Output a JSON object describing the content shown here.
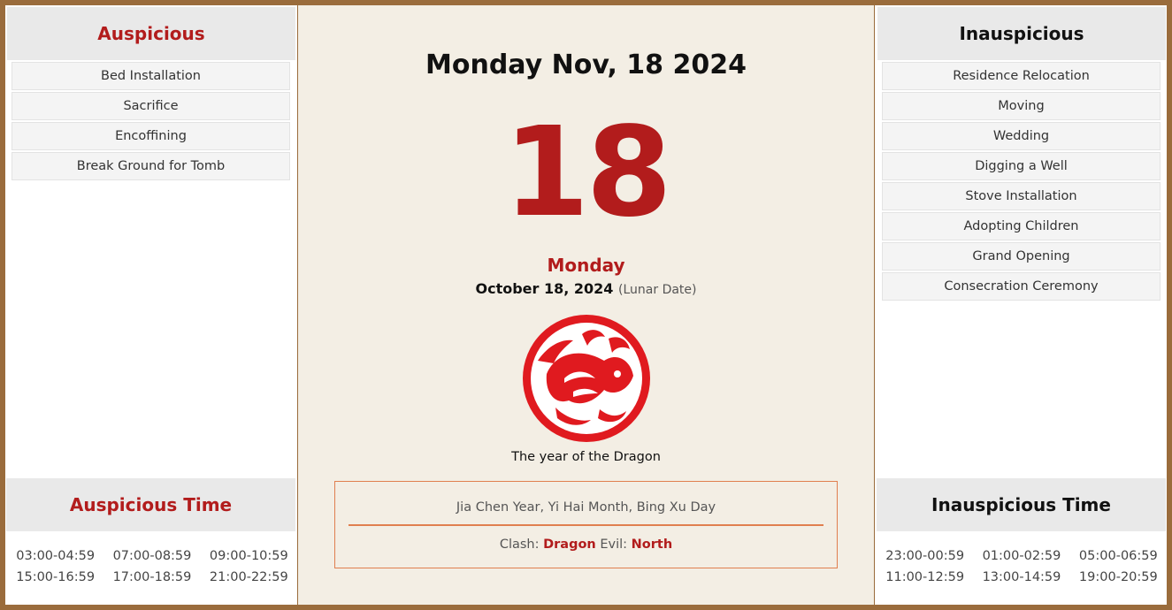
{
  "auspicious": {
    "title": "Auspicious",
    "items": [
      "Bed Installation",
      "Sacrifice",
      "Encoffining",
      "Break Ground for Tomb"
    ]
  },
  "auspicious_time": {
    "title": "Auspicious Time",
    "times": [
      "03:00-04:59",
      "07:00-08:59",
      "09:00-10:59",
      "15:00-16:59",
      "17:00-18:59",
      "21:00-22:59"
    ]
  },
  "inauspicious": {
    "title": "Inauspicious",
    "items": [
      "Residence Relocation",
      "Moving",
      "Wedding",
      "Digging a Well",
      "Stove Installation",
      "Adopting Children",
      "Grand Opening",
      "Consecration Ceremony"
    ]
  },
  "inauspicious_time": {
    "title": "Inauspicious Time",
    "times": [
      "23:00-00:59",
      "01:00-02:59",
      "05:00-06:59",
      "11:00-12:59",
      "13:00-14:59",
      "19:00-20:59"
    ]
  },
  "center": {
    "title": "Monday Nov, 18 2024",
    "day_number": "18",
    "weekday": "Monday",
    "lunar_date": "October 18, 2024",
    "lunar_note": "(Lunar Date)",
    "zodiac_icon": "dragon-papercut-icon",
    "zodiac_caption": "The year of the Dragon",
    "ganzhi": "Jia Chen Year, Yi Hai Month, Bing Xu Day",
    "clash_label": "Clash:",
    "clash_value": "Dragon",
    "evil_label": "Evil:",
    "evil_value": "North"
  },
  "colors": {
    "accent_red": "#b21c1c",
    "frame_brown": "#9a6c3c",
    "box_border": "#e07f4f"
  }
}
